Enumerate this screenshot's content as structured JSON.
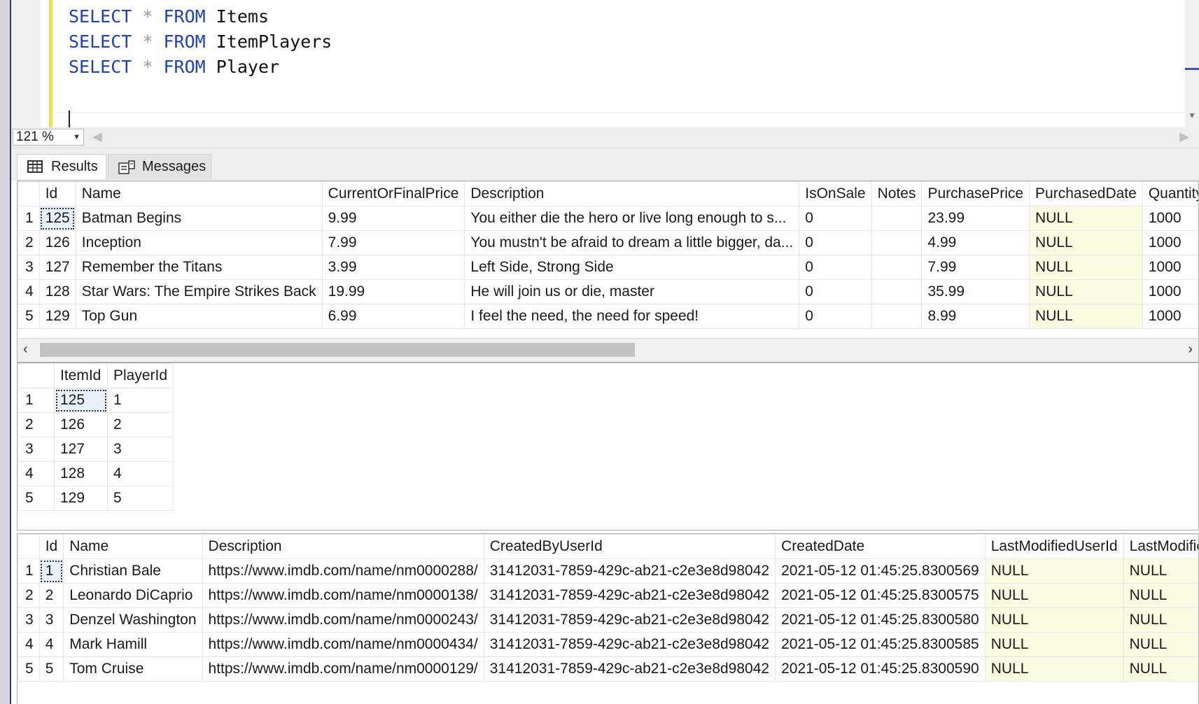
{
  "editor": {
    "lines": [
      {
        "kw1": "SELECT",
        "op": "*",
        "kw2": "FROM",
        "table": "Items"
      },
      {
        "kw1": "SELECT",
        "op": "*",
        "kw2": "FROM",
        "table": "ItemPlayers"
      },
      {
        "kw1": "SELECT",
        "op": "*",
        "kw2": "FROM",
        "table": "Player"
      }
    ]
  },
  "zoom": {
    "value": "121 %"
  },
  "tabs": {
    "results": "Results",
    "messages": "Messages"
  },
  "items": {
    "columns": [
      "",
      "Id",
      "Name",
      "CurrentOrFinalPrice",
      "Description",
      "IsOnSale",
      "Notes",
      "PurchasePrice",
      "PurchasedDate",
      "Quantity"
    ],
    "rows": [
      [
        "1",
        "125",
        "Batman Begins",
        "9.99",
        "You either die the hero or live long enough to s...",
        "0",
        "",
        "23.99",
        "NULL",
        "1000"
      ],
      [
        "2",
        "126",
        "Inception",
        "7.99",
        "You mustn't be afraid to dream a little bigger, da...",
        "0",
        "",
        "4.99",
        "NULL",
        "1000"
      ],
      [
        "3",
        "127",
        "Remember the Titans",
        "3.99",
        "Left Side, Strong Side",
        "0",
        "",
        "7.99",
        "NULL",
        "1000"
      ],
      [
        "4",
        "128",
        "Star Wars: The Empire Strikes Back",
        "19.99",
        "He will join us or die, master",
        "0",
        "",
        "35.99",
        "NULL",
        "1000"
      ],
      [
        "5",
        "129",
        "Top Gun",
        "6.99",
        "I feel the need, the need for speed!",
        "0",
        "",
        "8.99",
        "NULL",
        "1000"
      ]
    ]
  },
  "item_players": {
    "columns": [
      "",
      "ItemId",
      "PlayerId"
    ],
    "rows": [
      [
        "1",
        "125",
        "1"
      ],
      [
        "2",
        "126",
        "2"
      ],
      [
        "3",
        "127",
        "3"
      ],
      [
        "4",
        "128",
        "4"
      ],
      [
        "5",
        "129",
        "5"
      ]
    ]
  },
  "players": {
    "columns": [
      "",
      "Id",
      "Name",
      "Description",
      "CreatedByUserId",
      "CreatedDate",
      "LastModifiedUserId",
      "LastModified"
    ],
    "rows": [
      [
        "1",
        "1",
        "Christian Bale",
        "https://www.imdb.com/name/nm0000288/",
        "31412031-7859-429c-ab21-c2e3e8d98042",
        "2021-05-12 01:45:25.8300569",
        "NULL",
        "NULL"
      ],
      [
        "2",
        "2",
        "Leonardo DiCaprio",
        "https://www.imdb.com/name/nm0000138/",
        "31412031-7859-429c-ab21-c2e3e8d98042",
        "2021-05-12 01:45:25.8300575",
        "NULL",
        "NULL"
      ],
      [
        "3",
        "3",
        "Denzel Washington",
        "https://www.imdb.com/name/nm0000243/",
        "31412031-7859-429c-ab21-c2e3e8d98042",
        "2021-05-12 01:45:25.8300580",
        "NULL",
        "NULL"
      ],
      [
        "4",
        "4",
        "Mark Hamill",
        "https://www.imdb.com/name/nm0000434/",
        "31412031-7859-429c-ab21-c2e3e8d98042",
        "2021-05-12 01:45:25.8300585",
        "NULL",
        "NULL"
      ],
      [
        "5",
        "5",
        "Tom Cruise",
        "https://www.imdb.com/name/nm0000129/",
        "31412031-7859-429c-ab21-c2e3e8d98042",
        "2021-05-12 01:45:25.8300590",
        "NULL",
        "NULL"
      ]
    ]
  },
  "colors": {
    "keyword": "#1a41c7",
    "operator": "#9a9a9a",
    "null_cell": "#fbfbe2",
    "gutter_marker": "#f5df4d"
  },
  "icons": {
    "results_tab": "grid-icon",
    "messages_tab": "messages-icon"
  }
}
